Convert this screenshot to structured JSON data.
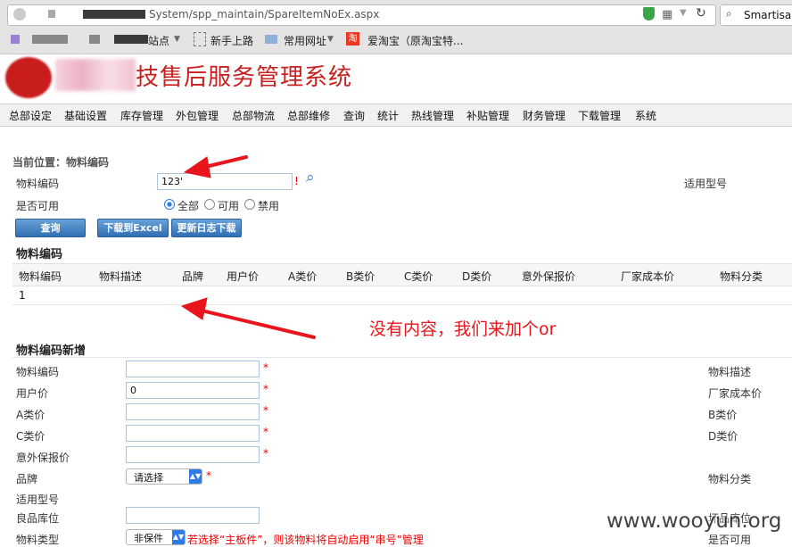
{
  "browser": {
    "url": "System/spp_maintain/SpareItemNoEx.aspx",
    "search_text": "Smartisan",
    "bookmarks": [
      "站点",
      "新手上路",
      "常用网址",
      "爱淘宝（原淘宝特..."
    ]
  },
  "header": {
    "title": "技售后服务管理系统"
  },
  "nav": [
    "总部设定",
    "基础设置",
    "库存管理",
    "外包管理",
    "总部物流",
    "总部维修",
    "查询",
    "统计",
    "热线管理",
    "补贴管理",
    "财务管理",
    "下载管理",
    "系统"
  ],
  "search_form": {
    "location": "当前位置：物料编码",
    "code_label": "物料编码",
    "code_value": "123'",
    "code_mark": "!",
    "model_label": "适用型号",
    "avail_label": "是否可用",
    "radios": [
      "全部",
      "可用",
      "禁用"
    ],
    "selected_radio": "全部",
    "btn_query": "查询",
    "btn_excel": "下载到Excel",
    "btn_log": "更新日志下载"
  },
  "results": {
    "title": "物料编码",
    "columns": [
      "物料编码",
      "物料描述",
      "品牌",
      "用户价",
      "A类价",
      "B类价",
      "C类价",
      "D类价",
      "意外保报价",
      "厂家成本价",
      "物料分类"
    ],
    "rows": [
      [
        "1"
      ]
    ]
  },
  "annotation": {
    "text": "没有内容，我们来加个or",
    "color": "#e8161c"
  },
  "add_form": {
    "title": "物料编码新增",
    "left_fields": [
      {
        "label": "物料编码",
        "value": ""
      },
      {
        "label": "用户价",
        "value": "0"
      },
      {
        "label": "A类价",
        "value": ""
      },
      {
        "label": "C类价",
        "value": ""
      },
      {
        "label": "意外保报价",
        "value": ""
      }
    ],
    "required_mark": "*",
    "brand_label": "品牌",
    "brand_select": "请选择",
    "model_label": "适用型号",
    "stock_label": "良品库位",
    "stock_value": "",
    "type_label": "物料类型",
    "type_select": "非保件",
    "type_note": "若选择“主板件”，则该物料将自动启用“串号”管理",
    "right_labels": [
      "物料描述",
      "厂家成本价",
      "B类价",
      "D类价",
      "物料分类",
      "坏品库位",
      "是否可用"
    ]
  },
  "watermark": "www.wooyun.org"
}
